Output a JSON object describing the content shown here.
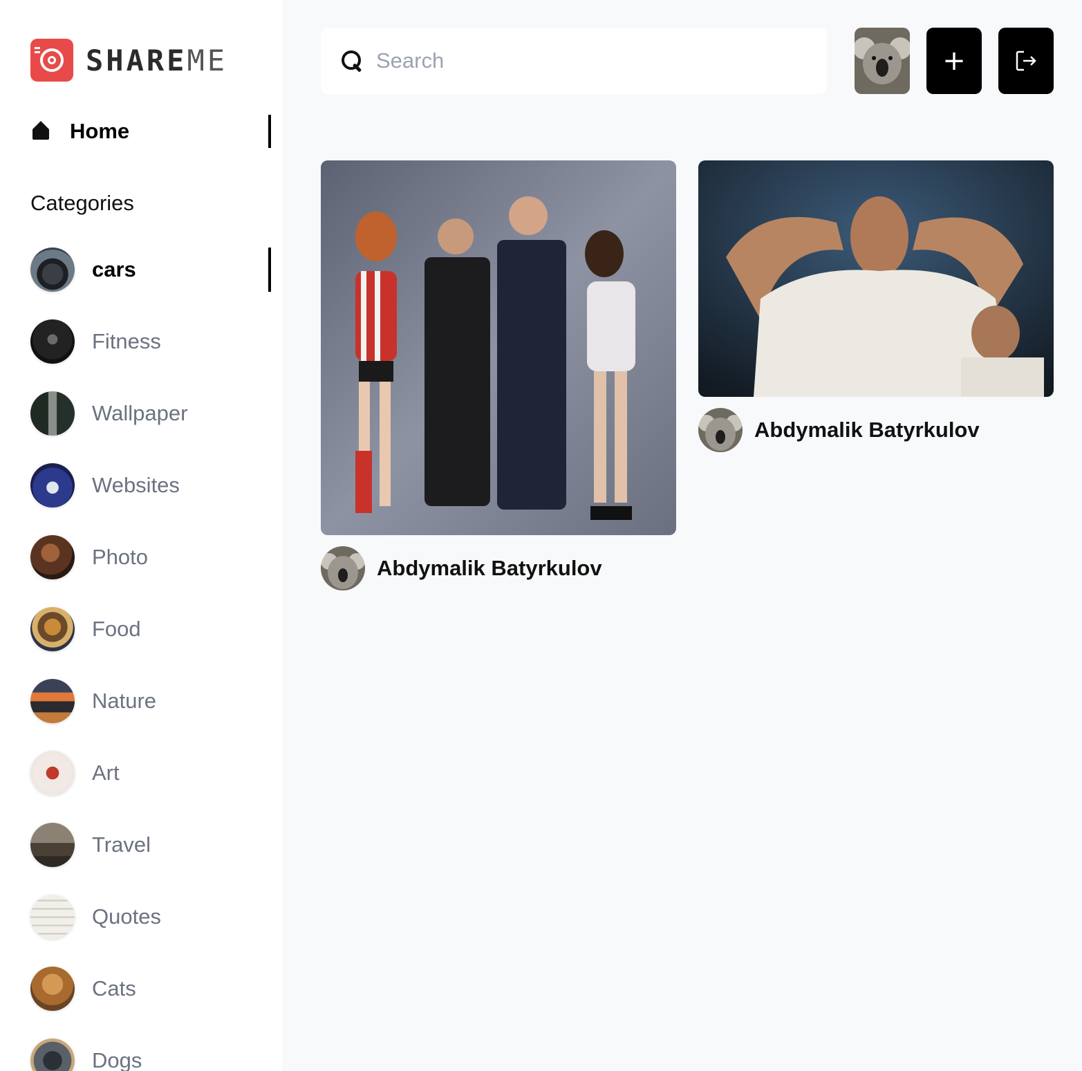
{
  "brand": {
    "name_part1": "SHARE",
    "name_part2": "ME"
  },
  "sidebar": {
    "home_label": "Home",
    "categories_title": "Categories",
    "categories": [
      {
        "label": "cars",
        "active": true
      },
      {
        "label": "Fitness",
        "active": false
      },
      {
        "label": "Wallpaper",
        "active": false
      },
      {
        "label": "Websites",
        "active": false
      },
      {
        "label": "Photo",
        "active": false
      },
      {
        "label": "Food",
        "active": false
      },
      {
        "label": "Nature",
        "active": false
      },
      {
        "label": "Art",
        "active": false
      },
      {
        "label": "Travel",
        "active": false
      },
      {
        "label": "Quotes",
        "active": false
      },
      {
        "label": "Cats",
        "active": false
      },
      {
        "label": "Dogs",
        "active": false
      }
    ]
  },
  "search": {
    "placeholder": "Search",
    "value": ""
  },
  "header": {
    "add_icon": "plus-icon",
    "logout_icon": "logout-icon"
  },
  "pins": [
    {
      "author": "Abdymalik Batyrkulov"
    },
    {
      "author": "Abdymalik Batyrkulov"
    }
  ],
  "colors": {
    "brand_red": "#e84a4a",
    "active_text": "#000000",
    "inactive_text": "#6b7280",
    "page_bg": "#f8f9fb"
  }
}
